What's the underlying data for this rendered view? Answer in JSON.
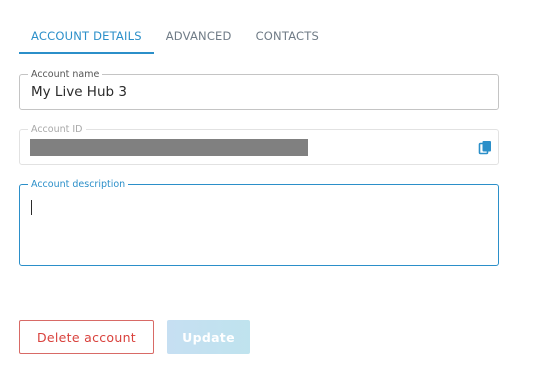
{
  "tabs": [
    {
      "label": "ACCOUNT DETAILS",
      "active": true
    },
    {
      "label": "ADVANCED",
      "active": false
    },
    {
      "label": "CONTACTS",
      "active": false
    }
  ],
  "form": {
    "account_name": {
      "label": "Account name",
      "value": "My Live Hub 3"
    },
    "account_id": {
      "label": "Account ID",
      "value_redacted": true,
      "copy_icon": "copy-icon"
    },
    "account_description": {
      "label": "Account description",
      "value": ""
    }
  },
  "actions": {
    "delete_label": "Delete account",
    "update_label": "Update",
    "update_disabled": true
  },
  "colors": {
    "accent": "#2b8fc9",
    "danger": "#d9413c",
    "redaction": "#808080",
    "disabled_button": "#c6dff2"
  }
}
